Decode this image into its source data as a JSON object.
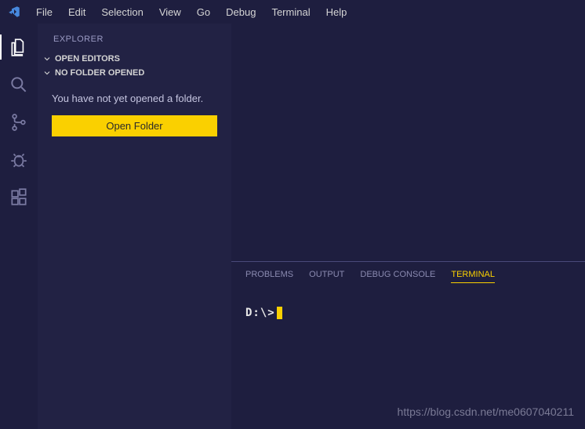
{
  "menu": {
    "file": "File",
    "edit": "Edit",
    "selection": "Selection",
    "view": "View",
    "go": "Go",
    "debug": "Debug",
    "terminal": "Terminal",
    "help": "Help"
  },
  "sidebar": {
    "title": "EXPLORER",
    "open_editors": "OPEN EDITORS",
    "no_folder_header": "NO FOLDER OPENED",
    "no_folder_message": "You have not yet opened a folder.",
    "open_folder_label": "Open Folder"
  },
  "panel": {
    "tabs": {
      "problems": "PROBLEMS",
      "output": "OUTPUT",
      "debug_console": "DEBUG CONSOLE",
      "terminal": "TERMINAL"
    }
  },
  "terminal": {
    "prompt": "D:\\>"
  },
  "watermark": "https://blog.csdn.net/me0607040211"
}
